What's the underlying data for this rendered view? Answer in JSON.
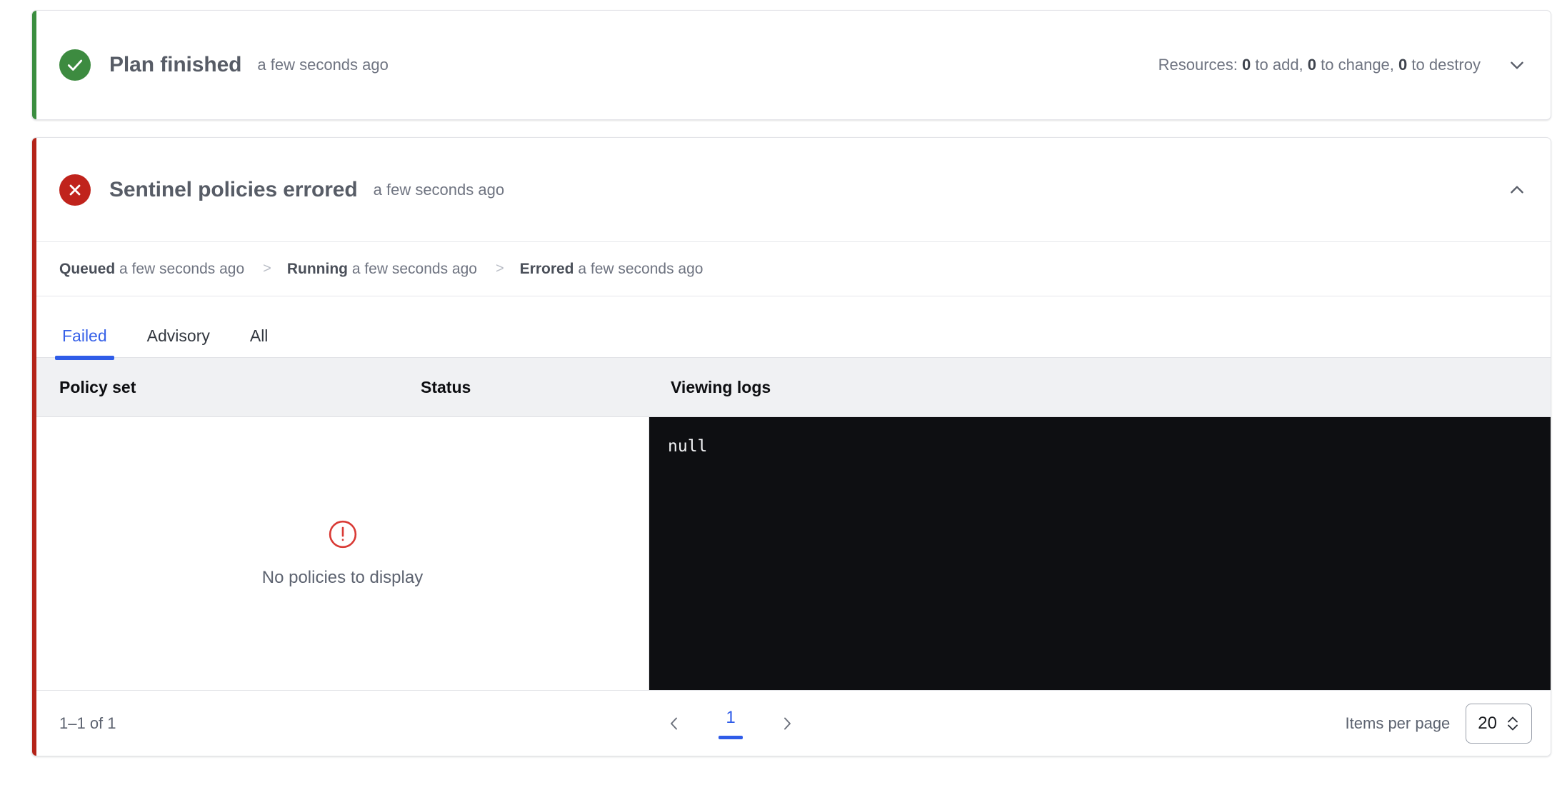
{
  "plan_card": {
    "status_icon": "check-circle-icon",
    "title": "Plan finished",
    "timestamp": "a few seconds ago",
    "resources_prefix": "Resources:",
    "resources_add": "0",
    "resources_add_label": " to add, ",
    "resources_change": "0",
    "resources_change_label": " to change, ",
    "resources_destroy": "0",
    "resources_destroy_label": " to destroy",
    "toggle_icon": "chevron-down-icon",
    "accent_color": "#3a8d3f",
    "icon_color": "#3d8b40"
  },
  "sentinel_card": {
    "status_icon": "x-circle-icon",
    "title": "Sentinel policies errored",
    "timestamp": "a few seconds ago",
    "toggle_icon": "chevron-up-icon",
    "accent_color": "#b32318",
    "icon_color": "#c0231c",
    "timeline": [
      {
        "state": "Queued",
        "time": "a few seconds ago"
      },
      {
        "state": "Running",
        "time": "a few seconds ago"
      },
      {
        "state": "Errored",
        "time": "a few seconds ago"
      }
    ],
    "timeline_separator": ">",
    "tabs": [
      {
        "label": "Failed",
        "active": true
      },
      {
        "label": "Advisory",
        "active": false
      },
      {
        "label": "All",
        "active": false
      }
    ],
    "table": {
      "columns": [
        "Policy set",
        "Status",
        "Viewing logs"
      ],
      "rows": [],
      "empty_state": {
        "icon": "alert-circle-icon",
        "message": "No policies to display",
        "icon_color": "#d93a35"
      },
      "log_output": "null"
    },
    "footer": {
      "range_text": "1–1 of 1",
      "prev_icon": "chevron-left-icon",
      "next_icon": "chevron-right-icon",
      "current_page": "1",
      "items_per_page_label": "Items per page",
      "items_per_page_value": "20",
      "items_per_page_icon": "chevron-up-down-icon"
    }
  },
  "accent_blue": "#2f5ce8"
}
